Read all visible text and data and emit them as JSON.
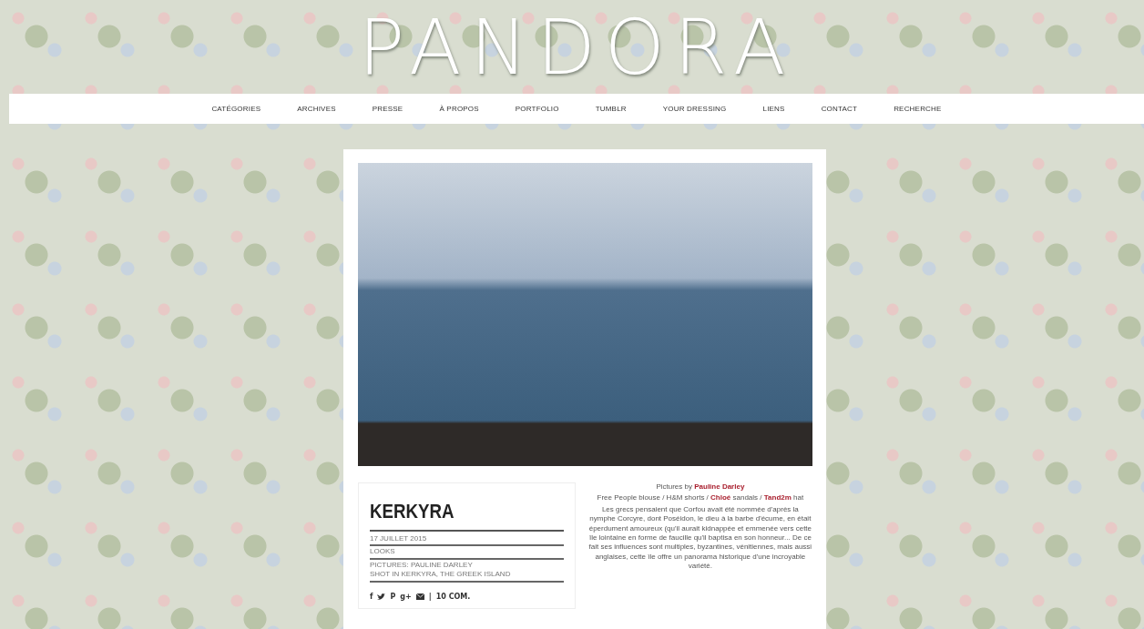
{
  "site": {
    "logo": "PANDORA"
  },
  "nav": [
    {
      "label": "CATÉGORIES"
    },
    {
      "label": "ARCHIVES"
    },
    {
      "label": "PRESSE"
    },
    {
      "label": "À PROPOS"
    },
    {
      "label": "PORTFOLIO"
    },
    {
      "label": "TUMBLR"
    },
    {
      "label": "YOUR DRESSING"
    },
    {
      "label": "LIENS"
    },
    {
      "label": "CONTACT"
    },
    {
      "label": "RECHERCHE"
    }
  ],
  "post": {
    "title": "KERKYRA",
    "meta": [
      {
        "lines": [
          "17 JUILLET 2015"
        ]
      },
      {
        "lines": [
          "LOOKS"
        ]
      },
      {
        "lines": [
          "PICTURES: PAULINE DARLEY",
          "SHOT IN KERKYRA, THE GREEK ISLAND"
        ]
      }
    ],
    "social": [
      {
        "kind": "text",
        "label": "f"
      },
      {
        "kind": "bird"
      },
      {
        "kind": "text",
        "label": "P"
      },
      {
        "kind": "text",
        "label": "g+"
      },
      {
        "kind": "envelope"
      }
    ],
    "separator": "|",
    "comments": "10 COM.",
    "credits": [
      "Pictures by **Pauline Darley**",
      "Free People blouse / H&M shorts / **Chloé** sandals / **Tand2m** hat"
    ],
    "body": "Les grecs pensaient que Corfou avait été nommée d'après la nymphe Corcyre, dont Poséidon, le dieu à la barbe d'écume, en était éperdument amoureux (qu'il aurait kidnappée et emmenée vers cette île lointaine en forme de faucille qu'il baptisa en son honneur... De ce fait ses influences sont multiples, byzantines, vénitiennes, mais aussi anglaises, cette île offre un panorama historique d'une incroyable variété."
  }
}
